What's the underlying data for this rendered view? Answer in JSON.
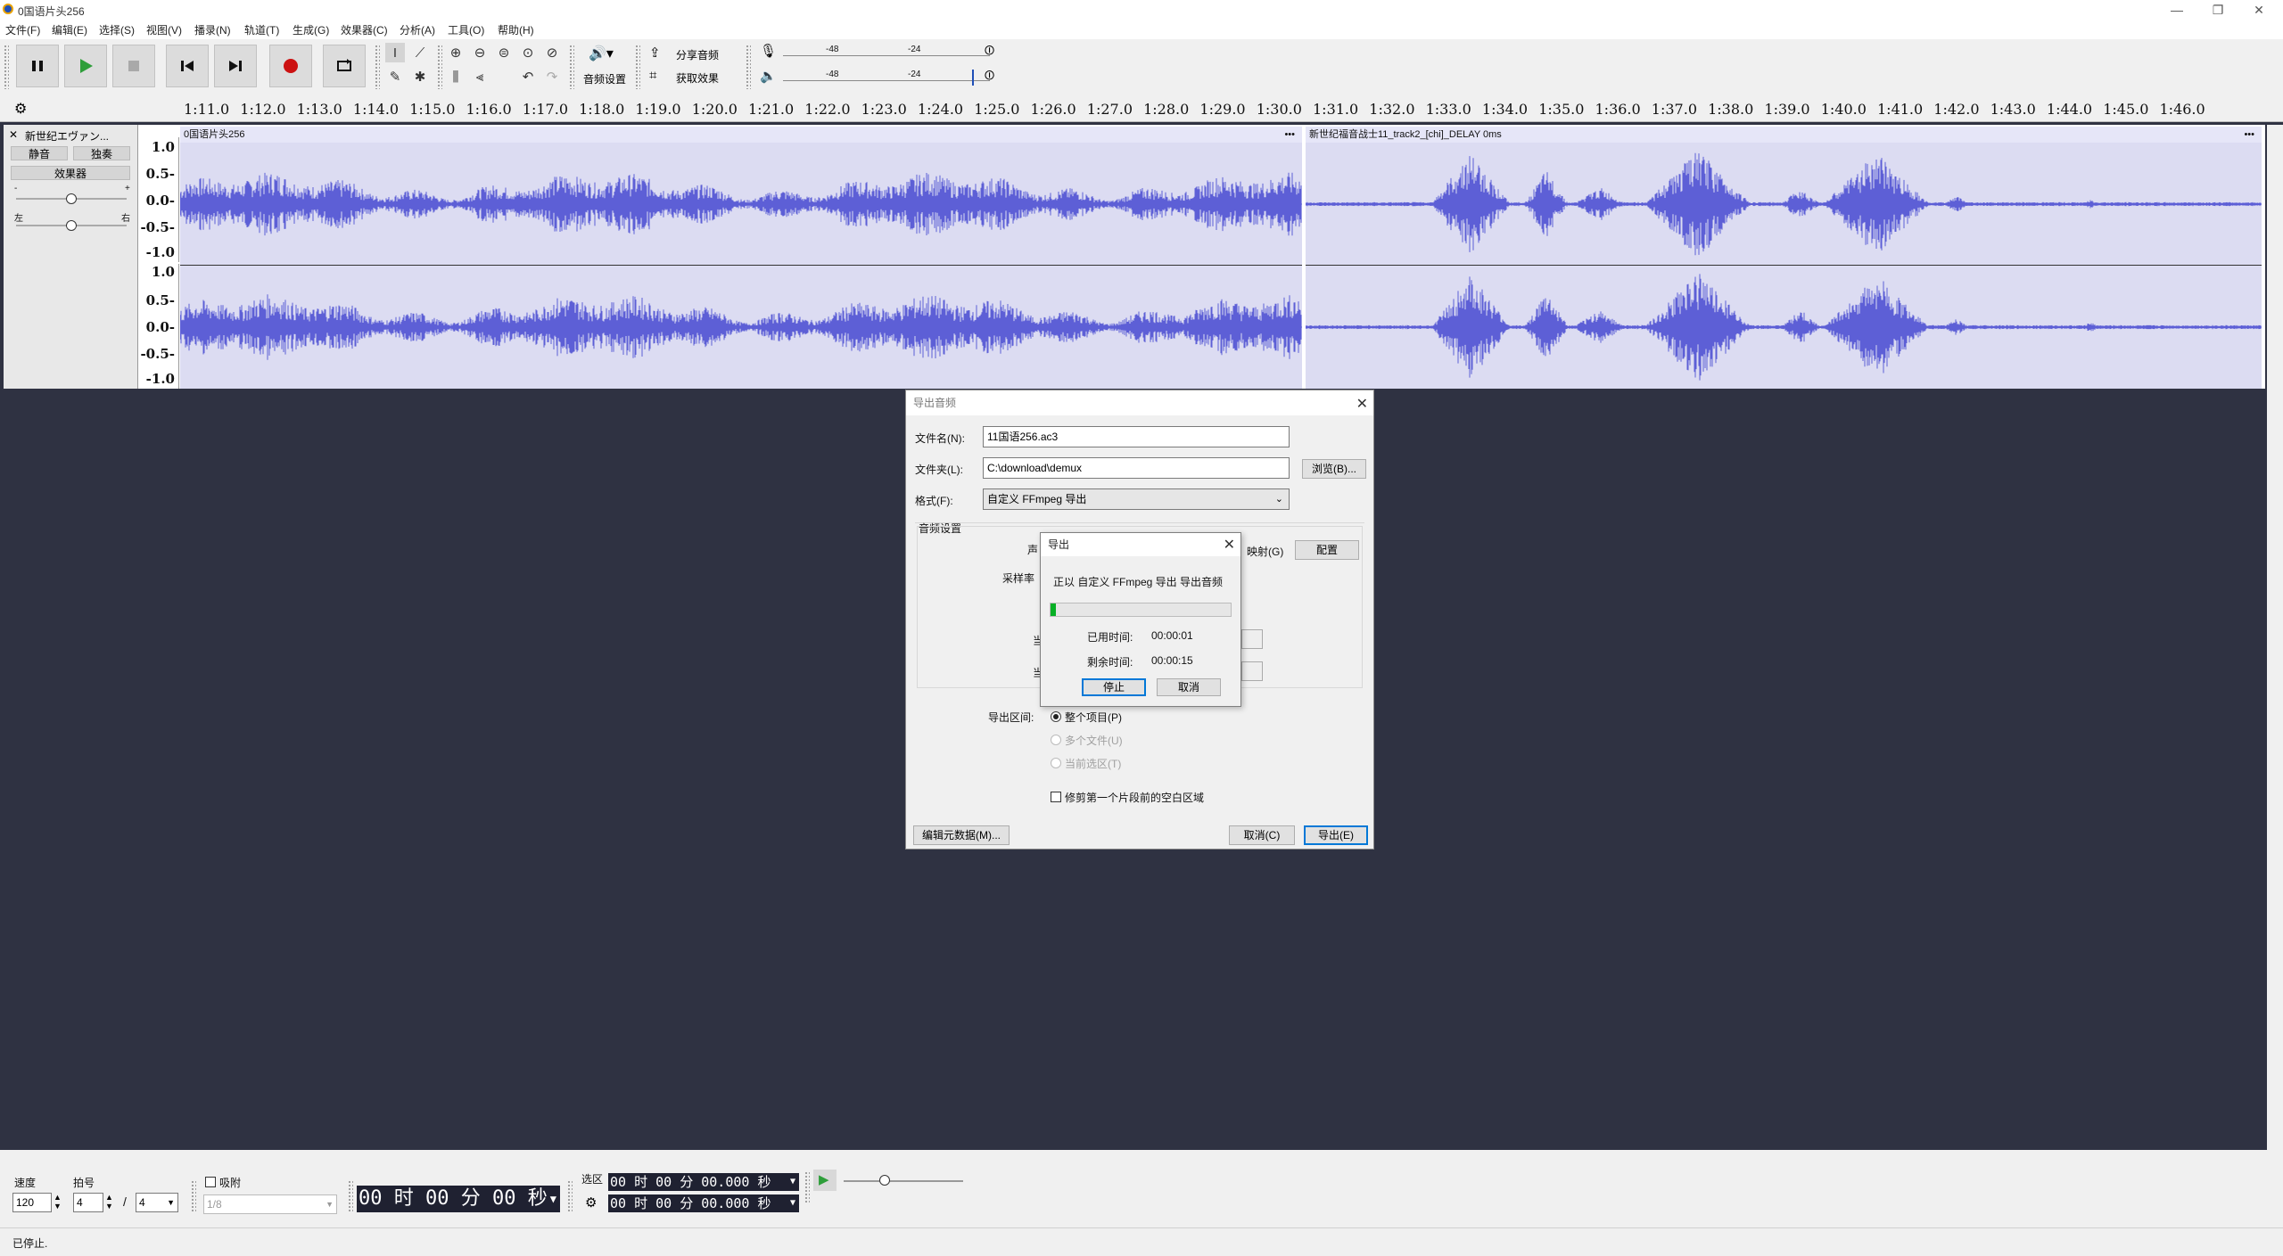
{
  "app": {
    "title": "0国语片头256",
    "window_controls": {
      "minimize": "—",
      "maximize": "❐",
      "close": "✕"
    }
  },
  "menu": [
    {
      "label": "文件(F)"
    },
    {
      "label": "编辑(E)"
    },
    {
      "label": "选择(S)"
    },
    {
      "label": "视图(V)"
    },
    {
      "label": "播录(N)"
    },
    {
      "label": "轨道(T)"
    },
    {
      "label": "生成(G)"
    },
    {
      "label": "效果器(C)"
    },
    {
      "label": "分析(A)"
    },
    {
      "label": "工具(O)"
    },
    {
      "label": "帮助(H)"
    }
  ],
  "toolbar": {
    "audio_setup_label": "音频设置",
    "share_audio_label": "分享音频",
    "get_effects_label": "获取效果",
    "meter_ticks": [
      "-48",
      "-24",
      "0"
    ],
    "record_meter_ticks": [
      "-48",
      "-24"
    ],
    "play_meter_ticks": [
      "-48",
      "-24"
    ]
  },
  "ruler": {
    "ticks": [
      "1:11.0",
      "1:12.0",
      "1:13.0",
      "1:14.0",
      "1:15.0",
      "1:16.0",
      "1:17.0",
      "1:18.0",
      "1:19.0",
      "1:20.0",
      "1:21.0",
      "1:22.0",
      "1:23.0",
      "1:24.0",
      "1:25.0",
      "1:26.0",
      "1:27.0",
      "1:28.0",
      "1:29.0",
      "1:30.0",
      "1:31.0",
      "1:32.0",
      "1:33.0",
      "1:34.0",
      "1:35.0",
      "1:36.0",
      "1:37.0",
      "1:38.0",
      "1:39.0",
      "1:40.0",
      "1:41.0",
      "1:42.0",
      "1:43.0",
      "1:44.0",
      "1:45.0",
      "1:46.0"
    ]
  },
  "track": {
    "name": "新世纪エヴァン...",
    "mute_label": "静音",
    "solo_label": "独奏",
    "effects_label": "效果器",
    "gain_min": "-",
    "gain_max": "+",
    "pan_left": "左",
    "pan_right": "右",
    "scale_labels": [
      "1.0",
      "0.5-",
      "0.0-",
      "-0.5-",
      "-1.0"
    ],
    "clips": [
      {
        "name": "0国语片头256",
        "menu": "•••"
      },
      {
        "name": "新世纪福音战士11_track2_[chi]_DELAY 0ms",
        "menu": "•••"
      }
    ],
    "waveform_color": "#5d5fd6"
  },
  "bottom": {
    "tempo_label": "速度",
    "tempo_value": "120",
    "beat_label": "拍号",
    "beat_upper": "4",
    "beat_lower": "4",
    "snap_label": "吸附",
    "snap_value": "1/8",
    "time_display": "00 时 00 分 00 秒",
    "selection_label": "选区",
    "selection_start": "00 时 00 分 00.000 秒",
    "selection_end": "00 时 00 分 00.000 秒",
    "slash": "/"
  },
  "status": {
    "text": "已停止."
  },
  "export_dialog": {
    "title": "导出音频",
    "filename_label": "文件名(N):",
    "filename_value": "11国语256.ac3",
    "folder_label": "文件夹(L):",
    "folder_value": "C:\\download\\demux",
    "browse_label": "浏览(B)...",
    "format_label": "格式(F):",
    "format_value": "自定义 FFmpeg 导出",
    "audio_settings_label": "音频设置",
    "channels_label": "声",
    "sample_rate_label": "采样率",
    "mapping_label": "映射(G)",
    "configure_label": "配置",
    "range_label": "导出区间:",
    "range_options": [
      {
        "label": "整个项目(P)",
        "selected": true,
        "enabled": true
      },
      {
        "label": "多个文件(U)",
        "selected": false,
        "enabled": false
      },
      {
        "label": "当前选区(T)",
        "selected": false,
        "enabled": false
      }
    ],
    "trim_label": "修剪第一个片段前的空白区域",
    "metadata_label": "编辑元数据(M)...",
    "cancel_label": "取消(C)",
    "export_label": "导出(E)",
    "hidden_label_1": "当",
    "hidden_label_2": "当"
  },
  "progress_dialog": {
    "title": "导出",
    "message": "正以 自定义 FFmpeg 导出 导出音频",
    "progress": 0.03,
    "elapsed_label": "已用时间:",
    "elapsed_value": "00:00:01",
    "remaining_label": "剩余时间:",
    "remaining_value": "00:00:15",
    "stop_label": "停止",
    "cancel_label": "取消",
    "bar_color": "#06b025"
  }
}
